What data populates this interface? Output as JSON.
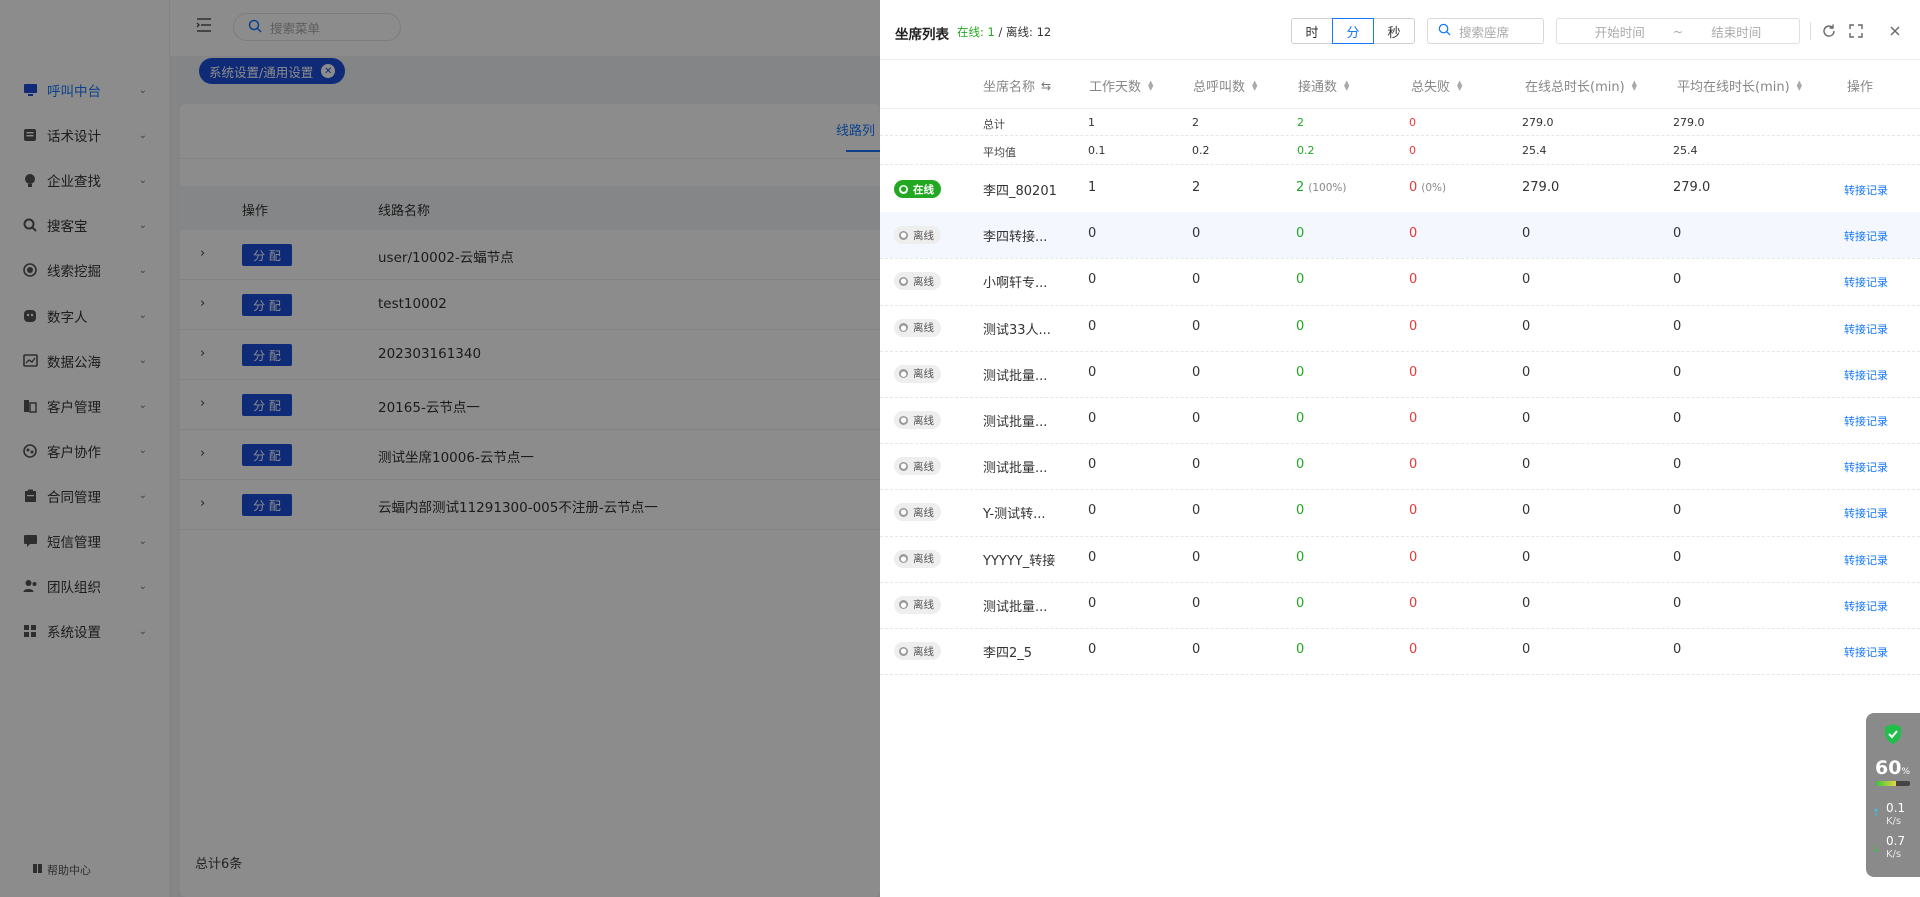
{
  "sidebar": {
    "items": [
      {
        "label": "呼叫中台",
        "icon": "monitor-icon",
        "active": true
      },
      {
        "label": "话术设计",
        "icon": "script-icon"
      },
      {
        "label": "企业查找",
        "icon": "bulb-icon"
      },
      {
        "label": "搜客宝",
        "icon": "search-customer-icon"
      },
      {
        "label": "线索挖掘",
        "icon": "target-icon"
      },
      {
        "label": "数字人",
        "icon": "digital-human-icon"
      },
      {
        "label": "数据公海",
        "icon": "data-pool-icon"
      },
      {
        "label": "客户管理",
        "icon": "customer-icon"
      },
      {
        "label": "客户协作",
        "icon": "collaboration-icon"
      },
      {
        "label": "合同管理",
        "icon": "contract-icon"
      },
      {
        "label": "短信管理",
        "icon": "sms-icon"
      },
      {
        "label": "团队组织",
        "icon": "team-icon"
      },
      {
        "label": "系统设置",
        "icon": "settings-icon"
      }
    ],
    "help": "帮助中心"
  },
  "topbar": {
    "search_placeholder": "搜索菜单"
  },
  "breadcrumb": {
    "tag": "系统设置/通用设置"
  },
  "lines_panel": {
    "tab": "线路列",
    "col_op": "操作",
    "col_name": "线路名称",
    "assign_label": "分 配",
    "rows": [
      "user/10002-云蝠节点",
      "test10002",
      "202303161340",
      "20165-云节点一",
      "测试坐席10006-云节点一",
      "云蝠内部测试11291300-005不注册-云节点一"
    ],
    "total": "总计6条"
  },
  "drawer": {
    "title": "坐席列表",
    "online_label": "在线:",
    "online_count": "1",
    "separator": " / ",
    "offline_label": "离线:",
    "offline_count": "12",
    "units": [
      "时",
      "分",
      "秒"
    ],
    "selected_unit": "分",
    "seat_search_placeholder": "搜索座席",
    "start_placeholder": "开始时间",
    "range_sep": "~",
    "end_placeholder": "结束时间",
    "columns": [
      "坐席名称",
      "工作天数",
      "总呼叫数",
      "接通数",
      "总失败",
      "在线总时长(min)",
      "平均在线时长(min)",
      "操作"
    ],
    "summary": {
      "total": {
        "label": "总计",
        "work_days": "1",
        "calls": "2",
        "connected": "2",
        "failed": "0",
        "online_total": "279.0",
        "online_avg": "279.0"
      },
      "average": {
        "label": "平均值",
        "work_days": "0.1",
        "calls": "0.2",
        "connected": "0.2",
        "failed": "0",
        "online_total": "25.4",
        "online_avg": "25.4"
      }
    },
    "status_online": "在线",
    "status_offline": "离线",
    "action": "转接记录",
    "rows": [
      {
        "status": "在线",
        "name": "李四_80201",
        "work_days": "1",
        "calls": "2",
        "connected": "2",
        "connected_pct": "(100%)",
        "failed": "0",
        "failed_pct": "(0%)",
        "online_total": "279.0",
        "online_avg": "279.0"
      },
      {
        "status": "离线",
        "name": "李四转接...",
        "work_days": "0",
        "calls": "0",
        "connected": "0",
        "failed": "0",
        "online_total": "0",
        "online_avg": "0"
      },
      {
        "status": "离线",
        "name": "小啊轩专...",
        "work_days": "0",
        "calls": "0",
        "connected": "0",
        "failed": "0",
        "online_total": "0",
        "online_avg": "0"
      },
      {
        "status": "离线",
        "name": "测试33人...",
        "work_days": "0",
        "calls": "0",
        "connected": "0",
        "failed": "0",
        "online_total": "0",
        "online_avg": "0"
      },
      {
        "status": "离线",
        "name": "测试批量...",
        "work_days": "0",
        "calls": "0",
        "connected": "0",
        "failed": "0",
        "online_total": "0",
        "online_avg": "0"
      },
      {
        "status": "离线",
        "name": "测试批量...",
        "work_days": "0",
        "calls": "0",
        "connected": "0",
        "failed": "0",
        "online_total": "0",
        "online_avg": "0"
      },
      {
        "status": "离线",
        "name": "测试批量...",
        "work_days": "0",
        "calls": "0",
        "connected": "0",
        "failed": "0",
        "online_total": "0",
        "online_avg": "0"
      },
      {
        "status": "离线",
        "name": "Y-测试转...",
        "work_days": "0",
        "calls": "0",
        "connected": "0",
        "failed": "0",
        "online_total": "0",
        "online_avg": "0"
      },
      {
        "status": "离线",
        "name": "YYYYY_转接",
        "work_days": "0",
        "calls": "0",
        "connected": "0",
        "failed": "0",
        "online_total": "0",
        "online_avg": "0"
      },
      {
        "status": "离线",
        "name": "测试批量...",
        "work_days": "0",
        "calls": "0",
        "connected": "0",
        "failed": "0",
        "online_total": "0",
        "online_avg": "0"
      },
      {
        "status": "离线",
        "name": "李四2_5",
        "work_days": "0",
        "calls": "0",
        "connected": "0",
        "failed": "0",
        "online_total": "0",
        "online_avg": "0"
      }
    ]
  },
  "network_widget": {
    "percent": "60",
    "percent_unit": "%",
    "usage_fraction": 0.6,
    "upload": "0.1",
    "upload_unit": "K/s",
    "download": "0.7",
    "download_unit": "K/s"
  },
  "colors": {
    "accent": "#1677ff",
    "brand_blue": "#1d4ed8",
    "online_green": "#22a822",
    "fail_red": "#e83a3a"
  }
}
